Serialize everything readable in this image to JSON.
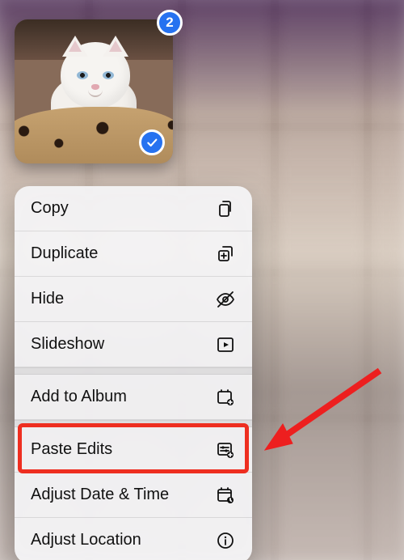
{
  "selection": {
    "count": "2",
    "checked": true
  },
  "menu": {
    "items": [
      {
        "id": "copy",
        "label": "Copy",
        "icon": "copy"
      },
      {
        "id": "duplicate",
        "label": "Duplicate",
        "icon": "duplicate"
      },
      {
        "id": "hide",
        "label": "Hide",
        "icon": "eye-slash"
      },
      {
        "id": "slideshow",
        "label": "Slideshow",
        "icon": "play-square"
      },
      {
        "id": "addtoalbum",
        "label": "Add to Album",
        "icon": "album-plus"
      },
      {
        "id": "pasteedits",
        "label": "Paste Edits",
        "icon": "sliders-plus"
      },
      {
        "id": "adjustdate",
        "label": "Adjust Date & Time",
        "icon": "calendar-clock"
      },
      {
        "id": "adjustloc",
        "label": "Adjust Location",
        "icon": "info"
      }
    ],
    "highlight_index": 5
  },
  "annotation": {
    "type": "arrow",
    "target": "pasteedits"
  }
}
